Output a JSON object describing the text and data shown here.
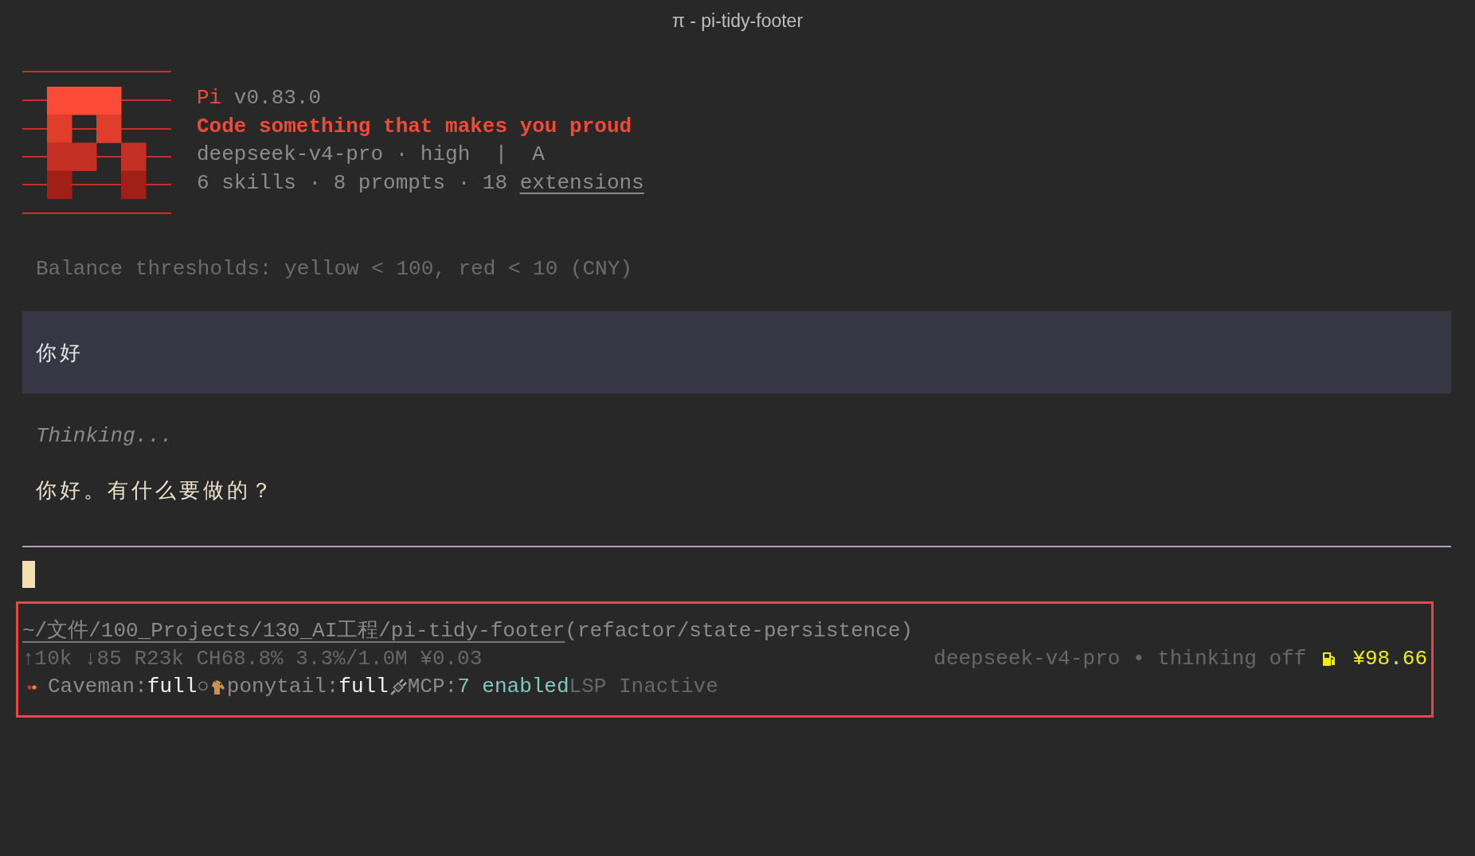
{
  "window": {
    "title": "π - pi-tidy-footer"
  },
  "banner": {
    "name": "Pi",
    "version": "v0.83.0",
    "tagline": "Code something that makes you proud",
    "model_line": "deepseek-v4-pro · high  |  A",
    "stats": "6 skills · 8 prompts · 18",
    "extensions_link": "extensions"
  },
  "notice": "Balance thresholds: yellow < 100, red < 10 (CNY)",
  "messages": [
    {
      "kind": "user",
      "text": "你好"
    },
    {
      "kind": "thinking",
      "text": "Thinking..."
    },
    {
      "kind": "assistant",
      "text": "你好。有什么要做的？"
    }
  ],
  "footer": {
    "path": "~/文件/100_Projects/130_AI工程/pi-tidy-footer",
    "branch": "(refactor/state-persistence)",
    "usage": "↑10k ↓85 R23k CH68.8% 3.3%/1.0M ¥0.03",
    "model_status": "deepseek-v4-pro • thinking off",
    "balance": "¥98.66",
    "caveman": {
      "label": "Caveman:",
      "value": "full"
    },
    "separator": "○",
    "ponytail": {
      "label": "ponytail:",
      "value": "full"
    },
    "mcp": {
      "label": "MCP:",
      "value": "7 enabled"
    },
    "lsp": "LSP Inactive"
  }
}
